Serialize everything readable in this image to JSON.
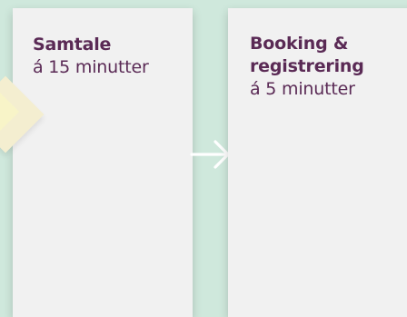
{
  "steps": [
    {
      "title": "Samtale",
      "duration": "á 15 minutter"
    },
    {
      "title_line1": "Booking &",
      "title_line2": "registrering",
      "duration": "á 5 minutter"
    }
  ],
  "icons": {
    "arrow": "arrow-right-icon",
    "marker": "diamond-marker-icon"
  },
  "colors": {
    "background": "#cfe8dc",
    "card": "#f1f1f1",
    "text": "#5a2a55",
    "arrow": "#ffffff",
    "marker": "#f4eed0"
  }
}
